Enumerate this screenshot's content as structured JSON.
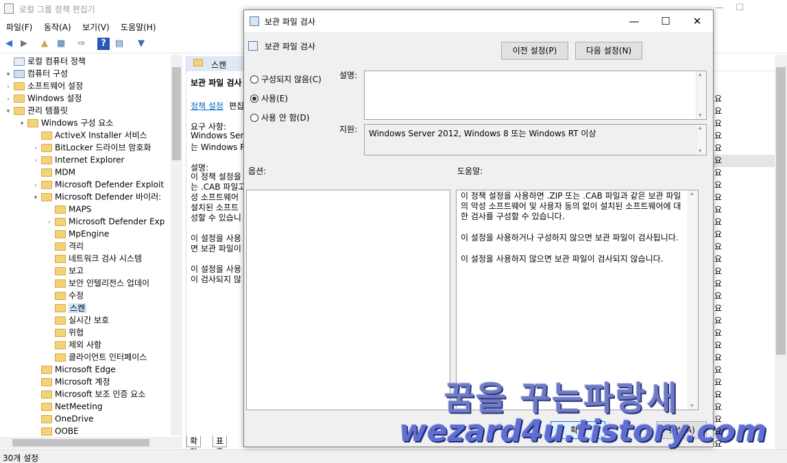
{
  "main_window": {
    "title": "로컬 그룹 정책 편집기",
    "window_controls": {
      "minimize": "—",
      "maximize": "☐"
    },
    "menu": [
      "파일(F)",
      "동작(A)",
      "보기(V)",
      "도움말(H)"
    ],
    "status": "30개 설정",
    "tabs": [
      "확장",
      "표준"
    ],
    "right_column_fragment": "요"
  },
  "tree": {
    "items": [
      {
        "label": "로컬 컴퓨터 정책",
        "level": 0,
        "arrow": "",
        "folder": false
      },
      {
        "label": "컴퓨터 구성",
        "level": 0,
        "arrow": "▾",
        "folder": false
      },
      {
        "label": "소프트웨어 설정",
        "level": 1,
        "arrow": "›",
        "folder": true
      },
      {
        "label": "Windows 설정",
        "level": 1,
        "arrow": "›",
        "folder": true
      },
      {
        "label": "관리 템플릿",
        "level": 1,
        "arrow": "▾",
        "folder": true
      },
      {
        "label": "Windows 구성 요소",
        "level": 2,
        "arrow": "▾",
        "folder": true
      },
      {
        "label": "ActiveX Installer 서비스",
        "level": 3,
        "arrow": "",
        "folder": true
      },
      {
        "label": "BitLocker 드라이브 암호화",
        "level": 3,
        "arrow": "›",
        "folder": true
      },
      {
        "label": "Internet Explorer",
        "level": 3,
        "arrow": "›",
        "folder": true
      },
      {
        "label": "MDM",
        "level": 3,
        "arrow": "",
        "folder": true
      },
      {
        "label": "Microsoft Defender Exploit",
        "level": 3,
        "arrow": "›",
        "folder": true
      },
      {
        "label": "Microsoft Defender 바이러:",
        "level": 3,
        "arrow": "▾",
        "folder": true
      },
      {
        "label": "MAPS",
        "level": 4,
        "arrow": "",
        "folder": true
      },
      {
        "label": "Microsoft Defender Exp",
        "level": 4,
        "arrow": "›",
        "folder": true
      },
      {
        "label": "MpEngine",
        "level": 4,
        "arrow": "",
        "folder": true
      },
      {
        "label": "격리",
        "level": 4,
        "arrow": "",
        "folder": true
      },
      {
        "label": "네트워크 검사 시스템",
        "level": 4,
        "arrow": "",
        "folder": true
      },
      {
        "label": "보고",
        "level": 4,
        "arrow": "",
        "folder": true
      },
      {
        "label": "보안 인텔리전스 업데이",
        "level": 4,
        "arrow": "",
        "folder": true
      },
      {
        "label": "수정",
        "level": 4,
        "arrow": "",
        "folder": true
      },
      {
        "label": "스캔",
        "level": 4,
        "arrow": "",
        "folder": true,
        "selected": true
      },
      {
        "label": "실시간 보호",
        "level": 4,
        "arrow": "",
        "folder": true
      },
      {
        "label": "위협",
        "level": 4,
        "arrow": "",
        "folder": true
      },
      {
        "label": "제외 사항",
        "level": 4,
        "arrow": "",
        "folder": true
      },
      {
        "label": "클라이언트 인터페이스",
        "level": 4,
        "arrow": "",
        "folder": true
      },
      {
        "label": "Microsoft Edge",
        "level": 3,
        "arrow": "",
        "folder": true
      },
      {
        "label": "Microsoft 계정",
        "level": 3,
        "arrow": "",
        "folder": true
      },
      {
        "label": "Microsoft 보조 인증 요소",
        "level": 3,
        "arrow": "",
        "folder": true
      },
      {
        "label": "NetMeeting",
        "level": 3,
        "arrow": "",
        "folder": true
      },
      {
        "label": "OneDrive",
        "level": 3,
        "arrow": "",
        "folder": true
      },
      {
        "label": "OOBE",
        "level": 3,
        "arrow": "",
        "folder": true
      }
    ]
  },
  "middle": {
    "header": "스캔",
    "title": "보관 파일 검사",
    "link": "정책 설정",
    "link_suffix": "편집",
    "req_label": "요구 사항:",
    "req_text1": "Windows Serve",
    "req_text2": "는 Windows RT",
    "desc_label": "설명:",
    "desc_lines": [
      "이 정책 설정을",
      "는 .CAB 파일고",
      "성 소프트웨어",
      "설치된 소프트",
      "성할 수 있습니"
    ],
    "p2_lines": [
      "이 설정을 사용",
      "면 보관 파일이"
    ],
    "p3_lines": [
      "이 설정을 사용",
      "이 검사되지 않"
    ]
  },
  "dialog": {
    "title": "보관 파일 검사",
    "heading": "보관 파일 검사",
    "controls": {
      "close": "✕",
      "maximize": "☐",
      "minimize": "—"
    },
    "prev_button": "이전 설정(P)",
    "next_button": "다음 설정(N)",
    "radios": [
      {
        "label": "구성되지 않음(C)",
        "checked": false
      },
      {
        "label": "사용(E)",
        "checked": true
      },
      {
        "label": "사용 안 함(D)",
        "checked": false
      }
    ],
    "comment_label": "설명:",
    "comment_value": "",
    "support_label": "지원:",
    "support_text": "Windows Server 2012, Windows 8 또는 Windows RT 이상",
    "options_label": "옵션:",
    "help_label": "도움말:",
    "help_paragraphs": [
      "이 정책 설정을 사용하면 .ZIP 또는 .CAB 파일과 같은 보관 파일의 악성 소프트웨어 및 사용자 동의 없이 설치된 소프트웨어에 대한 검사를 구성할 수 있습니다.",
      "이 설정을 사용하거나 구성하지 않으면 보관 파일이 검사됩니다.",
      "이 설정을 사용하지 않으면 보관 파일이 검사되지 않습니다."
    ],
    "ok_fragment": "확인",
    "cancel_fragment": "취소(A)"
  },
  "watermark": {
    "line1": "꿈을 꾸는파랑새",
    "line2": "wezard4u.tistory.com"
  }
}
